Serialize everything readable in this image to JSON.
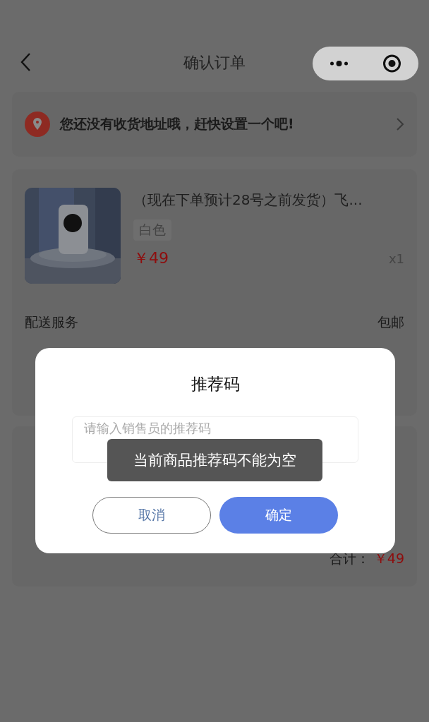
{
  "header": {
    "title": "确认订单"
  },
  "address": {
    "text": "您还没有收货地址哦，赶快设置一个吧!"
  },
  "product": {
    "title": "（现在下单预计28号之前发货）飞...",
    "variant": "白色",
    "price": "￥49",
    "quantity": "x1"
  },
  "order_rows": [
    {
      "label": "配送服务",
      "value": "包邮"
    }
  ],
  "total": {
    "label": "合计：",
    "amount": "￥49"
  },
  "dialog": {
    "title": "推荐码",
    "placeholder": "请输入销售员的推荐码",
    "buttons": [
      {
        "label": "取消",
        "kind": "secondary"
      },
      {
        "label": "确定",
        "kind": "primary"
      }
    ]
  },
  "toast": "当前商品推荐码不能为空"
}
